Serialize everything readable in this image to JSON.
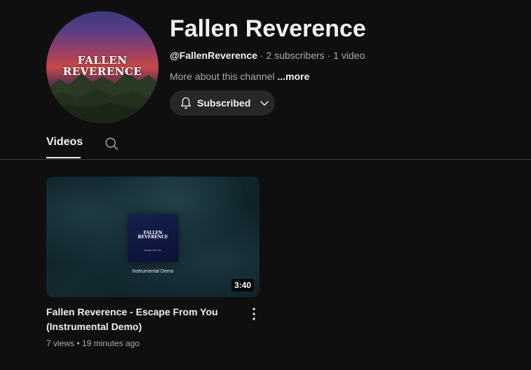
{
  "channel": {
    "title": "Fallen Reverence",
    "handle": "@FallenReverence",
    "stats_separator": "·",
    "subscribers": "2 subscribers",
    "videos_count": "1 video",
    "about_text": "More about this channel",
    "about_more": "...more",
    "avatar_text_line1": "FALLEN",
    "avatar_text_line2": "REVERENCE"
  },
  "subscribe_button": {
    "label": "Subscribed",
    "icon": "bell-icon",
    "dropdown_icon": "chevron-down-icon"
  },
  "tabs": [
    {
      "label": "Videos",
      "selected": true
    }
  ],
  "videos": [
    {
      "title": "Fallen Reverence - Escape From You (Instrumental Demo)",
      "duration": "3:40",
      "views": "7 views",
      "age": "19 minutes ago",
      "separator": "•",
      "thumbnail": {
        "art_title_line1": "FALLEN",
        "art_title_line2": "REVERENCE",
        "art_subtitle": "Escape From You",
        "caption": "Instrumental Demo"
      }
    }
  ],
  "colors": {
    "background": "#0f0f0f",
    "text_primary": "#f1f1f1",
    "text_secondary": "#aaaaaa",
    "button_bg": "#272727",
    "divider": "#3d3d3d"
  }
}
